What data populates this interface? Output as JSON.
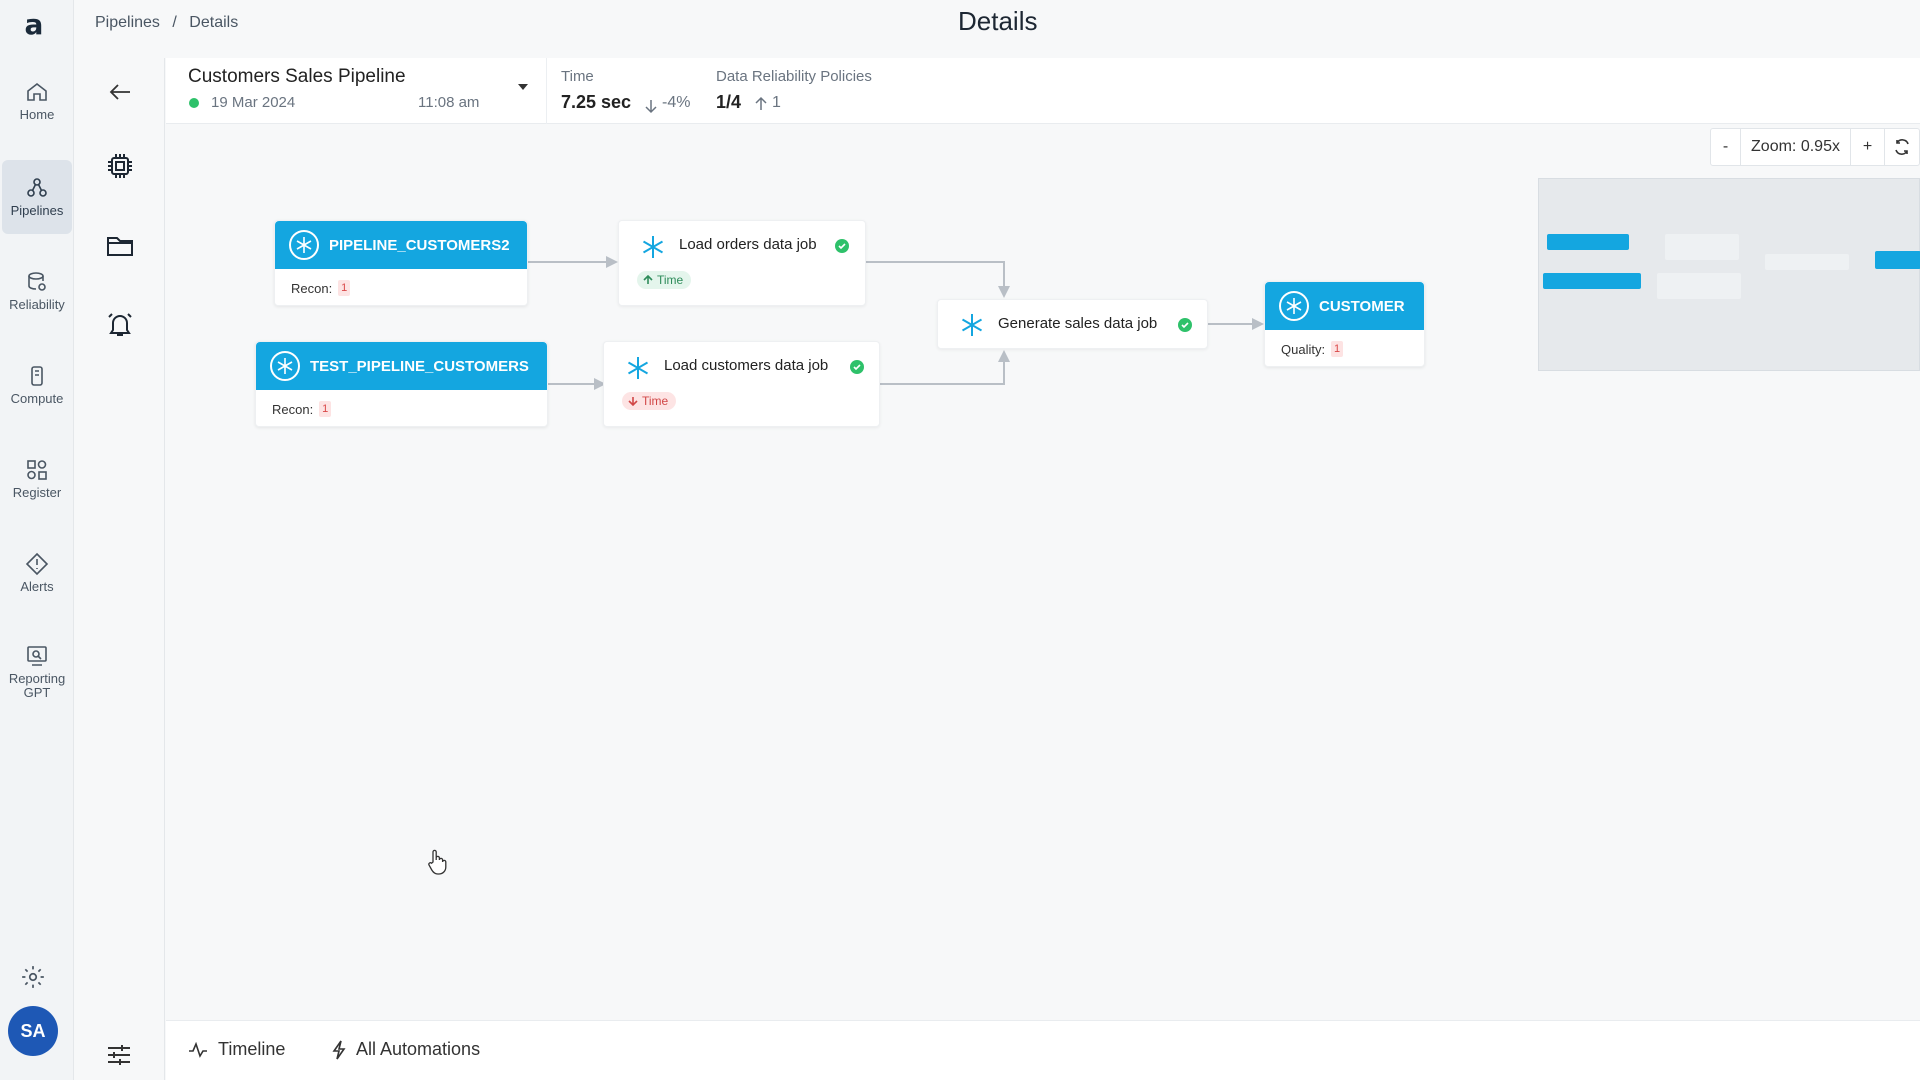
{
  "app": {
    "logo_text": "a",
    "nav": [
      {
        "label": "Home",
        "icon": "home-icon"
      },
      {
        "label": "Pipelines",
        "icon": "pipelines-icon",
        "active": true
      },
      {
        "label": "Reliability",
        "icon": "reliability-icon"
      },
      {
        "label": "Compute",
        "icon": "compute-icon"
      },
      {
        "label": "Register",
        "icon": "register-icon"
      },
      {
        "label": "Alerts",
        "icon": "alerts-icon"
      },
      {
        "label": "Reporting GPT",
        "icon": "reporting-gpt-icon"
      }
    ],
    "avatar_initials": "SA"
  },
  "breadcrumb": [
    "Pipelines",
    "/",
    "Details"
  ],
  "page_title": "Details",
  "header": {
    "pipeline_name": "Customers Sales Pipeline",
    "date": "19 Mar 2024",
    "time": "11:08 am",
    "time_metric": {
      "label": "Time",
      "value": "7.25 sec",
      "delta": "-4%"
    },
    "policies_metric": {
      "label": "Data Reliability Policies",
      "value": "1/4",
      "delta": "1"
    }
  },
  "zoom": {
    "minus": "-",
    "label": "Zoom: 0.95x",
    "plus": "+"
  },
  "graph": {
    "sources": [
      {
        "name": "PIPELINE_CUSTOMERS2",
        "foot_label": "Recon:",
        "badge": "1"
      },
      {
        "name": "TEST_PIPELINE_CUSTOMERS",
        "foot_label": "Recon:",
        "badge": "1"
      }
    ],
    "jobs": [
      {
        "name": "Load orders data job",
        "chip": "Time",
        "chip_dir": "up"
      },
      {
        "name": "Load customers data job",
        "chip": "Time",
        "chip_dir": "down"
      },
      {
        "name": "Generate sales data job"
      }
    ],
    "target": {
      "name": "CUSTOMER",
      "foot_label": "Quality:",
      "badge": "1"
    }
  },
  "bottom": {
    "timeline": "Timeline",
    "automations": "All Automations"
  },
  "colors": {
    "node_blue": "#14a6e0",
    "success_green": "#2ec16a",
    "danger_red": "#d94848",
    "avatar_blue": "#1e58b5"
  }
}
